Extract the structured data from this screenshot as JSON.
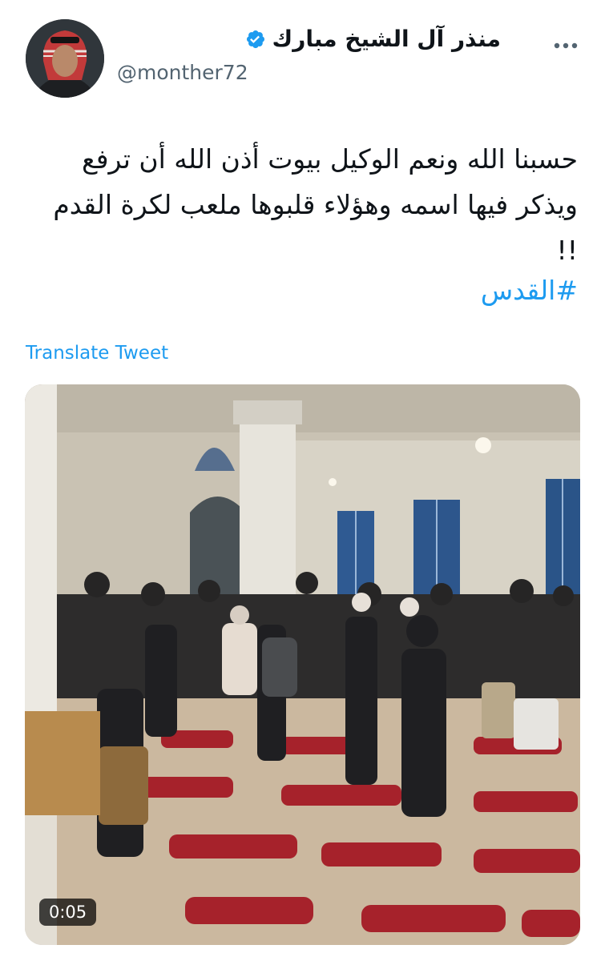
{
  "author": {
    "display_name": "منذر آل الشيخ مبارك",
    "handle": "@monther72",
    "verified_icon": "verified-badge-icon",
    "avatar_icon": "avatar"
  },
  "tweet": {
    "text": "حسبنا الله ونعم الوكيل بيوت أذن الله أن ترفع ويذكر فيها اسمه وهؤلاء قلبوها ملعب لكرة القدم !!",
    "hashtag": "#القدس"
  },
  "actions": {
    "translate_label": "Translate Tweet",
    "more_icon": "more-options-icon"
  },
  "media": {
    "duration": "0:05"
  },
  "colors": {
    "accent": "#1d9bf0",
    "text": "#0f1419",
    "secondary": "#536471"
  }
}
